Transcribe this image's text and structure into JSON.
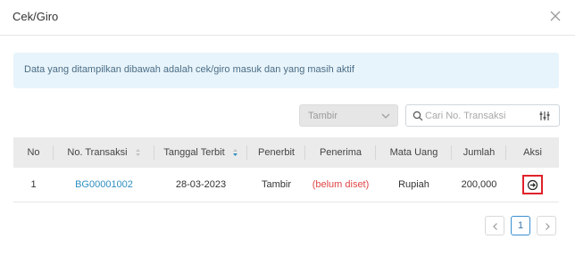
{
  "dialog": {
    "title": "Cek/Giro"
  },
  "info": {
    "message": "Data yang ditampilkan dibawah adalah cek/giro masuk dan yang masih aktif"
  },
  "filters": {
    "select_value": "Tambir",
    "search_placeholder": "Cari No. Transaksi"
  },
  "table": {
    "headers": [
      "No",
      "No. Transaksi",
      "Tanggal Terbit",
      "Penerbit",
      "Penerima",
      "Mata Uang",
      "Jumlah",
      "Aksi"
    ],
    "rows": [
      {
        "no": "1",
        "transaction": "BG00001002",
        "date": "28-03-2023",
        "issuer": "Tambir",
        "recipient": "(belum diset)",
        "currency": "Rupiah",
        "amount": "200,000"
      }
    ]
  },
  "pagination": {
    "current": "1"
  },
  "colors": {
    "link": "#2f8ec0",
    "warning": "#e04646",
    "highlight": "#e0212a",
    "info_bg": "#e8f4fb"
  },
  "icons": {
    "close": "close-icon",
    "chevron": "chevron-down-icon",
    "search": "search-icon",
    "filter": "filter-icon",
    "action": "arrow-right-circle-icon"
  }
}
